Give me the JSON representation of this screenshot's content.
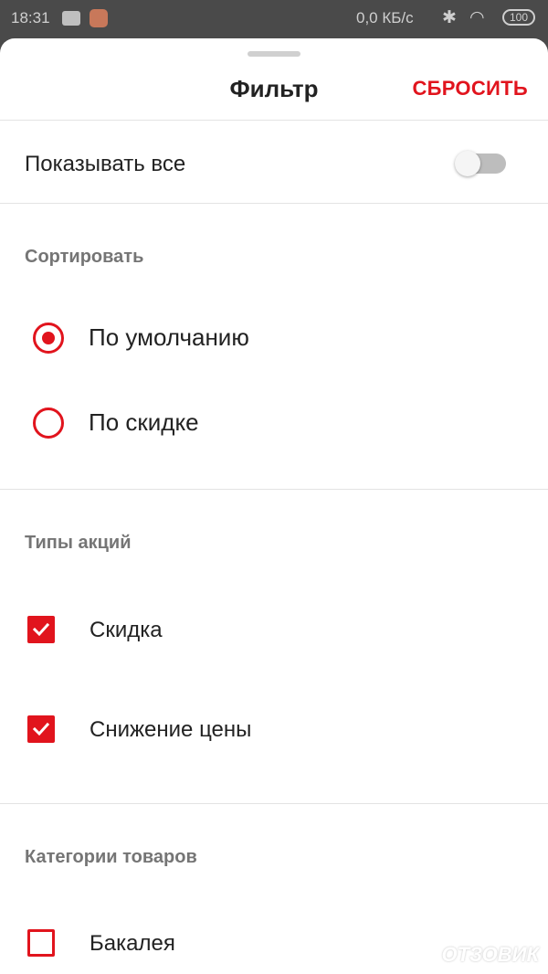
{
  "status_bar": {
    "time": "18:31",
    "network_speed": "0,0 КБ/с",
    "battery": "100",
    "icons": [
      "message-icon",
      "app-notification-icon",
      "bluetooth-icon",
      "wifi-icon",
      "battery-icon"
    ]
  },
  "sheet": {
    "title": "Фильтр",
    "reset_label": "СБРОСИТЬ",
    "show_all": {
      "label": "Показывать все",
      "enabled": false
    }
  },
  "sort": {
    "header": "Сортировать",
    "options": [
      {
        "label": "По умолчанию",
        "selected": true
      },
      {
        "label": "По скидке",
        "selected": false
      }
    ]
  },
  "promo_types": {
    "header": "Типы акций",
    "items": [
      {
        "label": "Скидка",
        "checked": true
      },
      {
        "label": "Снижение цены",
        "checked": true
      }
    ]
  },
  "categories": {
    "header": "Категории товаров",
    "items": [
      {
        "label": "Бакалея",
        "checked": false
      }
    ]
  },
  "watermark": "ОТЗОВИК",
  "colors": {
    "accent": "#e1141d",
    "toggle_off": "#bdbdbd",
    "section_header": "#757575"
  }
}
